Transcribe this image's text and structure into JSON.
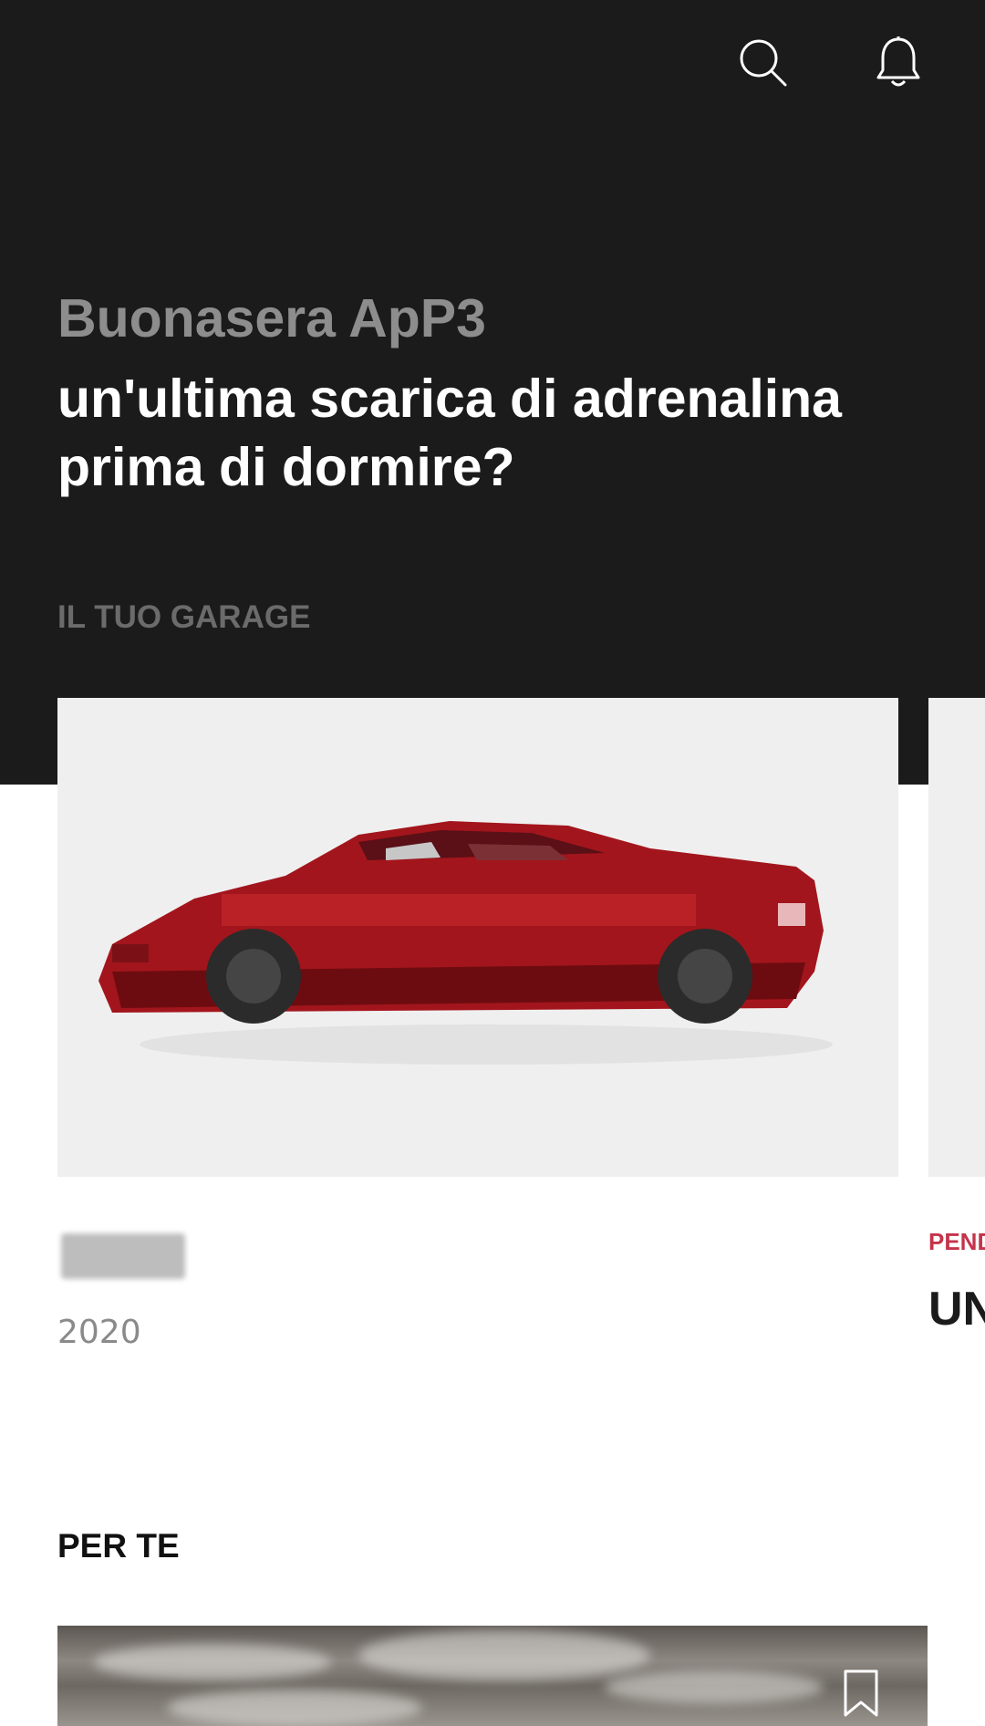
{
  "header": {
    "icons": [
      "search-icon",
      "bell-icon"
    ]
  },
  "greeting": {
    "name_line": "Buonasera ApP3",
    "headline": "un'ultima scarica di adrenalina prima di dormire?"
  },
  "garage": {
    "section_title": "IL TUO GARAGE",
    "cards": [
      {
        "year": "2020",
        "image": "red-sports-car-pixelated",
        "name_redacted": true
      },
      {
        "badge": "PEND",
        "title": "UN"
      }
    ]
  },
  "for_you": {
    "section_title": "PER TE",
    "card": {
      "image": "cloudy-sky",
      "icon": "bookmark-icon"
    }
  },
  "colors": {
    "hero_bg": "#1b1b1c",
    "accent_red": "#c4344b",
    "car_red": "#a3151c"
  }
}
